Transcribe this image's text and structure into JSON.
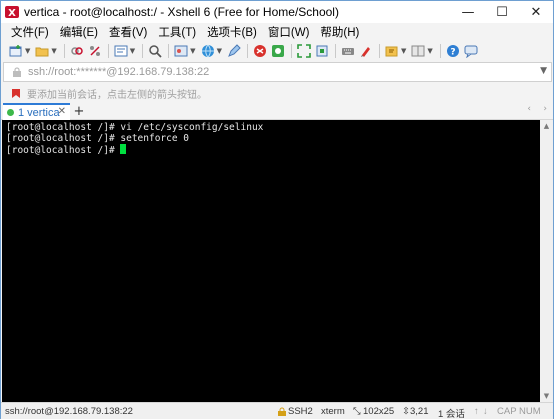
{
  "window": {
    "title": "vertica - root@localhost:/ - Xshell 6 (Free for Home/School)",
    "controls": {
      "minimize": "—",
      "maximize": "☐",
      "close": "✕"
    }
  },
  "menu": [
    "文件(F)",
    "编辑(E)",
    "查看(V)",
    "工具(T)",
    "选项卡(B)",
    "窗口(W)",
    "帮助(H)"
  ],
  "address": {
    "text": "ssh://root:*******@192.168.79.138:22"
  },
  "hint": {
    "text": "要添加当前会话，点击左侧的箭头按钮。"
  },
  "tab": {
    "label": "1 vertica",
    "close": "✕",
    "add": "+"
  },
  "terminal": {
    "lines": [
      "[root@localhost /]# vi /etc/sysconfig/selinux",
      "[root@localhost /]# setenforce 0",
      "[root@localhost /]# "
    ]
  },
  "status": {
    "connection": "ssh://root@192.168.79.138:22",
    "protocol": "SSH2",
    "terminal_type": "xterm",
    "size": "102x25",
    "cursor_pos": "3,21",
    "sessions": "1 会话",
    "caps": "CAP",
    "num": "NUM"
  },
  "colors": {
    "accent": "#2e7bd6",
    "terminal_bg": "#000000",
    "cursor": "#00e040"
  }
}
